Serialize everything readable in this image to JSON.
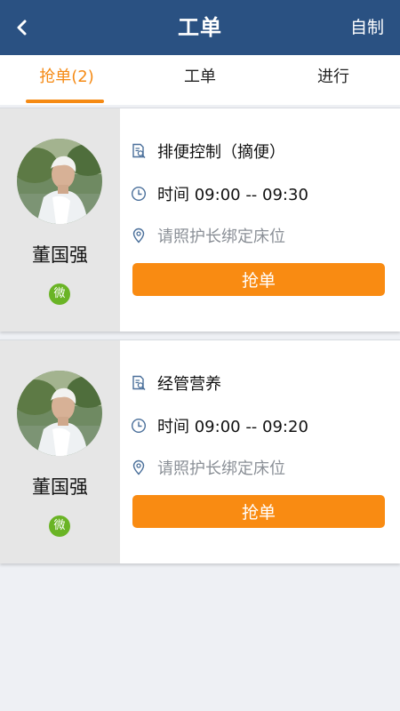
{
  "header": {
    "title": "工单",
    "action": "自制"
  },
  "tabs": [
    {
      "label": "抢单(2)",
      "active": true
    },
    {
      "label": "工单",
      "active": false
    },
    {
      "label": "进行",
      "active": false
    }
  ],
  "orders": [
    {
      "patient_name": "董国强",
      "badge": "微",
      "task": "排便控制（摘便）",
      "time": "时间 09:00 -- 09:30",
      "location": "请照护长绑定床位",
      "button": "抢单"
    },
    {
      "patient_name": "董国强",
      "badge": "微",
      "task": "经管营养",
      "time": "时间 09:00 -- 09:20",
      "location": "请照护长绑定床位",
      "button": "抢单"
    }
  ],
  "colors": {
    "header_bg": "#2a5182",
    "accent": "#f98b12",
    "wechat_green": "#6ab425"
  }
}
